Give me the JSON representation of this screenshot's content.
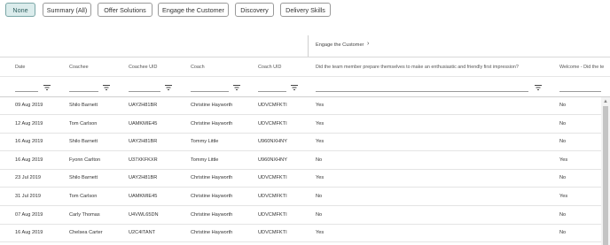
{
  "tabs": [
    {
      "label": "None",
      "active": true
    },
    {
      "label": "Summary (All)",
      "active": false
    },
    {
      "label": "Offer Solutions",
      "active": false
    },
    {
      "label": "Engage the Customer",
      "active": false
    },
    {
      "label": "Discovery",
      "active": false
    },
    {
      "label": "Delivery Skills",
      "active": false
    }
  ],
  "group_header": {
    "label": "Engage the Customer",
    "chevron": "chevron-right-icon"
  },
  "columns": [
    "Date",
    "Coachee",
    "Coachee UID",
    "Coach",
    "Coach UID",
    "Did the team member prepare themselves to make an enthusiastic and friendly first impression?",
    "Welcome - Did the te"
  ],
  "rows": [
    [
      "09 Aug 2019",
      "Shilo Barnett",
      "UAY2H81BR",
      "Christine Hayworth",
      "UDVCMFKTI",
      "Yes",
      "No"
    ],
    [
      "12 Aug 2019",
      "Tom Carlson",
      "UAMKMIE45",
      "Christine Hayworth",
      "UDVCMFKTI",
      "Yes",
      "No"
    ],
    [
      "16 Aug 2019",
      "Shilo Barnett",
      "UAY2H81BR",
      "Tommy Little",
      "U960NXHNY",
      "Yes",
      "No"
    ],
    [
      "16 Aug 2019",
      "Fyonn Carlton",
      "U37XKFKXR",
      "Tommy Little",
      "U960NXHNY",
      "No",
      "Yes"
    ],
    [
      "23 Jul 2019",
      "Shilo Barnett",
      "UAY2H81BR",
      "Christine Hayworth",
      "UDVCMFKTI",
      "Yes",
      "No"
    ],
    [
      "31 Jul 2019",
      "Tom Carlson",
      "UAMKMIE45",
      "Christine Hayworth",
      "UDVCMFKTI",
      "No",
      "Yes"
    ],
    [
      "07 Aug 2019",
      "Carly Thomas",
      "U4VWL65DN",
      "Christine Hayworth",
      "UDVCMFKTI",
      "No",
      "No"
    ],
    [
      "16 Aug 2019",
      "Chelsea Carter",
      "U2C4ITANT",
      "Christine Hayworth",
      "UDVCMFKTI",
      "Yes",
      "No"
    ]
  ],
  "colors": {
    "active_tab_bg": "#dbecec",
    "border": "#9a9a9a",
    "scroll_thumb": "#c4c4c4"
  }
}
